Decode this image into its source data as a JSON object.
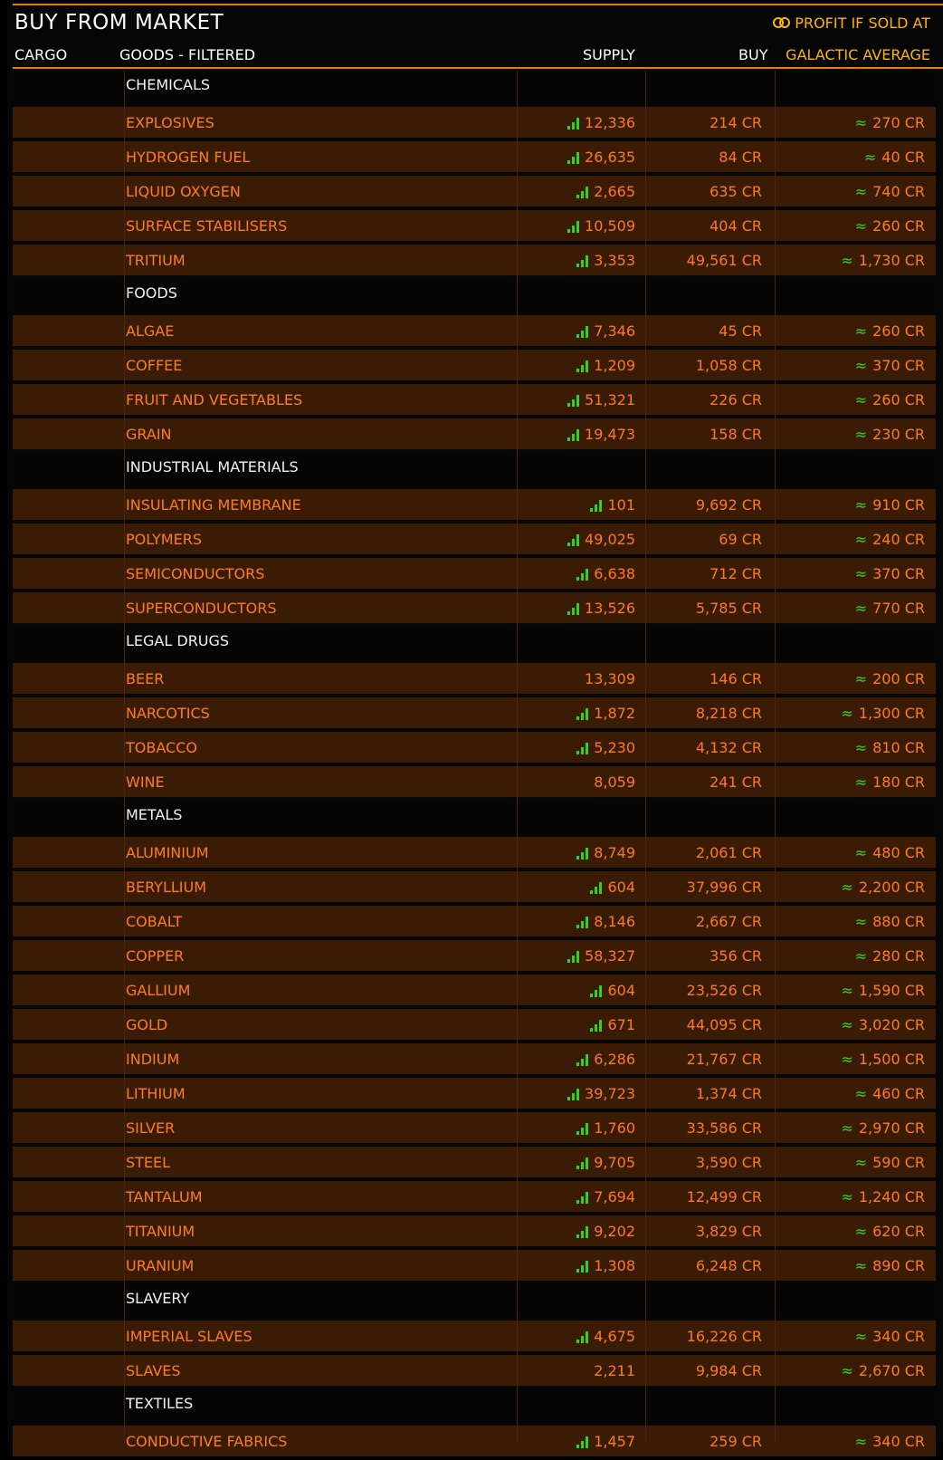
{
  "header": {
    "title": "BUY FROM MARKET",
    "profit_label": "PROFIT IF SOLD AT"
  },
  "columns": {
    "cargo": "CARGO",
    "goods": "GOODS - FILTERED",
    "supply": "SUPPLY",
    "buy": "BUY",
    "average": "GALACTIC AVERAGE"
  },
  "colors": {
    "accent": "#e8781e",
    "item_text": "#ff7d1e",
    "row_bg": "#3a1b06",
    "signal": "#32d21e",
    "average_header": "#ffb400"
  },
  "rows": [
    {
      "type": "cat",
      "name": "CHEMICALS"
    },
    {
      "type": "item",
      "name": "EXPLOSIVES",
      "supply": "12,336",
      "signal": true,
      "buy": "214 CR",
      "avg": "270 CR"
    },
    {
      "type": "item",
      "name": "HYDROGEN FUEL",
      "supply": "26,635",
      "signal": true,
      "buy": "84 CR",
      "avg": "40 CR"
    },
    {
      "type": "item",
      "name": "LIQUID OXYGEN",
      "supply": "2,665",
      "signal": true,
      "buy": "635 CR",
      "avg": "740 CR"
    },
    {
      "type": "item",
      "name": "SURFACE STABILISERS",
      "supply": "10,509",
      "signal": true,
      "buy": "404 CR",
      "avg": "260 CR"
    },
    {
      "type": "item",
      "name": "TRITIUM",
      "supply": "3,353",
      "signal": true,
      "buy": "49,561 CR",
      "avg": "1,730 CR"
    },
    {
      "type": "cat",
      "name": "FOODS"
    },
    {
      "type": "item",
      "name": "ALGAE",
      "supply": "7,346",
      "signal": true,
      "buy": "45 CR",
      "avg": "260 CR"
    },
    {
      "type": "item",
      "name": "COFFEE",
      "supply": "1,209",
      "signal": true,
      "buy": "1,058 CR",
      "avg": "370 CR"
    },
    {
      "type": "item",
      "name": "FRUIT AND VEGETABLES",
      "supply": "51,321",
      "signal": true,
      "buy": "226 CR",
      "avg": "260 CR"
    },
    {
      "type": "item",
      "name": "GRAIN",
      "supply": "19,473",
      "signal": true,
      "buy": "158 CR",
      "avg": "230 CR"
    },
    {
      "type": "cat",
      "name": "INDUSTRIAL MATERIALS"
    },
    {
      "type": "item",
      "name": "INSULATING MEMBRANE",
      "supply": "101",
      "signal": true,
      "buy": "9,692 CR",
      "avg": "910 CR"
    },
    {
      "type": "item",
      "name": "POLYMERS",
      "supply": "49,025",
      "signal": true,
      "buy": "69 CR",
      "avg": "240 CR"
    },
    {
      "type": "item",
      "name": "SEMICONDUCTORS",
      "supply": "6,638",
      "signal": true,
      "buy": "712 CR",
      "avg": "370 CR"
    },
    {
      "type": "item",
      "name": "SUPERCONDUCTORS",
      "supply": "13,526",
      "signal": true,
      "buy": "5,785 CR",
      "avg": "770 CR"
    },
    {
      "type": "cat",
      "name": "LEGAL DRUGS"
    },
    {
      "type": "item",
      "name": "BEER",
      "supply": "13,309",
      "signal": false,
      "buy": "146 CR",
      "avg": "200 CR"
    },
    {
      "type": "item",
      "name": "NARCOTICS",
      "supply": "1,872",
      "signal": true,
      "buy": "8,218 CR",
      "avg": "1,300 CR"
    },
    {
      "type": "item",
      "name": "TOBACCO",
      "supply": "5,230",
      "signal": true,
      "buy": "4,132 CR",
      "avg": "810 CR"
    },
    {
      "type": "item",
      "name": "WINE",
      "supply": "8,059",
      "signal": false,
      "buy": "241 CR",
      "avg": "180 CR"
    },
    {
      "type": "cat",
      "name": "METALS"
    },
    {
      "type": "item",
      "name": "ALUMINIUM",
      "supply": "8,749",
      "signal": true,
      "buy": "2,061 CR",
      "avg": "480 CR"
    },
    {
      "type": "item",
      "name": "BERYLLIUM",
      "supply": "604",
      "signal": true,
      "buy": "37,996 CR",
      "avg": "2,200 CR"
    },
    {
      "type": "item",
      "name": "COBALT",
      "supply": "8,146",
      "signal": true,
      "buy": "2,667 CR",
      "avg": "880 CR"
    },
    {
      "type": "item",
      "name": "COPPER",
      "supply": "58,327",
      "signal": true,
      "buy": "356 CR",
      "avg": "280 CR"
    },
    {
      "type": "item",
      "name": "GALLIUM",
      "supply": "604",
      "signal": true,
      "buy": "23,526 CR",
      "avg": "1,590 CR"
    },
    {
      "type": "item",
      "name": "GOLD",
      "supply": "671",
      "signal": true,
      "buy": "44,095 CR",
      "avg": "3,020 CR"
    },
    {
      "type": "item",
      "name": "INDIUM",
      "supply": "6,286",
      "signal": true,
      "buy": "21,767 CR",
      "avg": "1,500 CR"
    },
    {
      "type": "item",
      "name": "LITHIUM",
      "supply": "39,723",
      "signal": true,
      "buy": "1,374 CR",
      "avg": "460 CR"
    },
    {
      "type": "item",
      "name": "SILVER",
      "supply": "1,760",
      "signal": true,
      "buy": "33,586 CR",
      "avg": "2,970 CR"
    },
    {
      "type": "item",
      "name": "STEEL",
      "supply": "9,705",
      "signal": true,
      "buy": "3,590 CR",
      "avg": "590 CR"
    },
    {
      "type": "item",
      "name": "TANTALUM",
      "supply": "7,694",
      "signal": true,
      "buy": "12,499 CR",
      "avg": "1,240 CR"
    },
    {
      "type": "item",
      "name": "TITANIUM",
      "supply": "9,202",
      "signal": true,
      "buy": "3,829 CR",
      "avg": "620 CR"
    },
    {
      "type": "item",
      "name": "URANIUM",
      "supply": "1,308",
      "signal": true,
      "buy": "6,248 CR",
      "avg": "890 CR"
    },
    {
      "type": "cat",
      "name": "SLAVERY"
    },
    {
      "type": "item",
      "name": "IMPERIAL SLAVES",
      "supply": "4,675",
      "signal": true,
      "buy": "16,226 CR",
      "avg": "340 CR"
    },
    {
      "type": "item",
      "name": "SLAVES",
      "supply": "2,211",
      "signal": false,
      "buy": "9,984 CR",
      "avg": "2,670 CR"
    },
    {
      "type": "cat",
      "name": "TEXTILES"
    },
    {
      "type": "item",
      "name": "CONDUCTIVE FABRICS",
      "supply": "1,457",
      "signal": true,
      "buy": "259 CR",
      "avg": "340 CR"
    }
  ]
}
